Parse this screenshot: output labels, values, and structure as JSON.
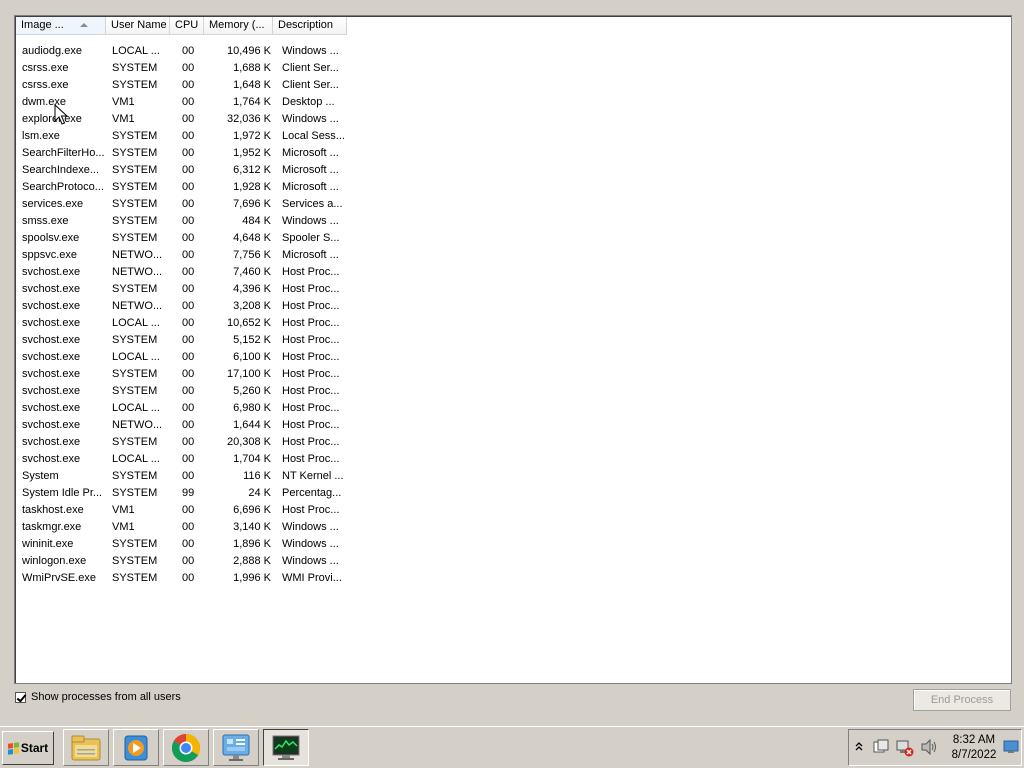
{
  "columns": [
    {
      "label": "Image ...",
      "sorted": true
    },
    {
      "label": "User Name"
    },
    {
      "label": "CPU"
    },
    {
      "label": "Memory (..."
    },
    {
      "label": "Description"
    }
  ],
  "processes": [
    {
      "image": "audiodg.exe",
      "user": "LOCAL ...",
      "cpu": "00",
      "memory": "10,496 K",
      "description": "Windows ..."
    },
    {
      "image": "csrss.exe",
      "user": "SYSTEM",
      "cpu": "00",
      "memory": "1,688 K",
      "description": "Client Ser..."
    },
    {
      "image": "csrss.exe",
      "user": "SYSTEM",
      "cpu": "00",
      "memory": "1,648 K",
      "description": "Client Ser..."
    },
    {
      "image": "dwm.exe",
      "user": "VM1",
      "cpu": "00",
      "memory": "1,764 K",
      "description": "Desktop ..."
    },
    {
      "image": "explorer.exe",
      "user": "VM1",
      "cpu": "00",
      "memory": "32,036 K",
      "description": "Windows ..."
    },
    {
      "image": "lsm.exe",
      "user": "SYSTEM",
      "cpu": "00",
      "memory": "1,972 K",
      "description": "Local Sess..."
    },
    {
      "image": "SearchFilterHo...",
      "user": "SYSTEM",
      "cpu": "00",
      "memory": "1,952 K",
      "description": "Microsoft ..."
    },
    {
      "image": "SearchIndexe...",
      "user": "SYSTEM",
      "cpu": "00",
      "memory": "6,312 K",
      "description": "Microsoft ..."
    },
    {
      "image": "SearchProtoco...",
      "user": "SYSTEM",
      "cpu": "00",
      "memory": "1,928 K",
      "description": "Microsoft ..."
    },
    {
      "image": "services.exe",
      "user": "SYSTEM",
      "cpu": "00",
      "memory": "7,696 K",
      "description": "Services a..."
    },
    {
      "image": "smss.exe",
      "user": "SYSTEM",
      "cpu": "00",
      "memory": "484 K",
      "description": "Windows ..."
    },
    {
      "image": "spoolsv.exe",
      "user": "SYSTEM",
      "cpu": "00",
      "memory": "4,648 K",
      "description": "Spooler S..."
    },
    {
      "image": "sppsvc.exe",
      "user": "NETWO...",
      "cpu": "00",
      "memory": "7,756 K",
      "description": "Microsoft ..."
    },
    {
      "image": "svchost.exe",
      "user": "NETWO...",
      "cpu": "00",
      "memory": "7,460 K",
      "description": "Host Proc..."
    },
    {
      "image": "svchost.exe",
      "user": "SYSTEM",
      "cpu": "00",
      "memory": "4,396 K",
      "description": "Host Proc..."
    },
    {
      "image": "svchost.exe",
      "user": "NETWO...",
      "cpu": "00",
      "memory": "3,208 K",
      "description": "Host Proc..."
    },
    {
      "image": "svchost.exe",
      "user": "LOCAL ...",
      "cpu": "00",
      "memory": "10,652 K",
      "description": "Host Proc..."
    },
    {
      "image": "svchost.exe",
      "user": "SYSTEM",
      "cpu": "00",
      "memory": "5,152 K",
      "description": "Host Proc..."
    },
    {
      "image": "svchost.exe",
      "user": "LOCAL ...",
      "cpu": "00",
      "memory": "6,100 K",
      "description": "Host Proc..."
    },
    {
      "image": "svchost.exe",
      "user": "SYSTEM",
      "cpu": "00",
      "memory": "17,100 K",
      "description": "Host Proc..."
    },
    {
      "image": "svchost.exe",
      "user": "SYSTEM",
      "cpu": "00",
      "memory": "5,260 K",
      "description": "Host Proc..."
    },
    {
      "image": "svchost.exe",
      "user": "LOCAL ...",
      "cpu": "00",
      "memory": "6,980 K",
      "description": "Host Proc..."
    },
    {
      "image": "svchost.exe",
      "user": "NETWO...",
      "cpu": "00",
      "memory": "1,644 K",
      "description": "Host Proc..."
    },
    {
      "image": "svchost.exe",
      "user": "SYSTEM",
      "cpu": "00",
      "memory": "20,308 K",
      "description": "Host Proc..."
    },
    {
      "image": "svchost.exe",
      "user": "LOCAL ...",
      "cpu": "00",
      "memory": "1,704 K",
      "description": "Host Proc..."
    },
    {
      "image": "System",
      "user": "SYSTEM",
      "cpu": "00",
      "memory": "116 K",
      "description": "NT Kernel ..."
    },
    {
      "image": "System Idle Pr...",
      "user": "SYSTEM",
      "cpu": "99",
      "memory": "24 K",
      "description": "Percentag..."
    },
    {
      "image": "taskhost.exe",
      "user": "VM1",
      "cpu": "00",
      "memory": "6,696 K",
      "description": "Host Proc..."
    },
    {
      "image": "taskmgr.exe",
      "user": "VM1",
      "cpu": "00",
      "memory": "3,140 K",
      "description": "Windows ..."
    },
    {
      "image": "wininit.exe",
      "user": "SYSTEM",
      "cpu": "00",
      "memory": "1,896 K",
      "description": "Windows ..."
    },
    {
      "image": "winlogon.exe",
      "user": "SYSTEM",
      "cpu": "00",
      "memory": "2,888 K",
      "description": "Windows ..."
    },
    {
      "image": "WmiPrvSE.exe",
      "user": "SYSTEM",
      "cpu": "00",
      "memory": "1,996 K",
      "description": "WMI Provi..."
    }
  ],
  "footer": {
    "show_all_label": "Show processes from all users",
    "show_all_checked": true,
    "end_process_label": "End Process",
    "end_process_enabled": false
  },
  "taskbar": {
    "start_label": "Start",
    "apps": [
      {
        "icon": "file-explorer-icon",
        "name": "Windows Explorer"
      },
      {
        "icon": "media-player-icon",
        "name": "Windows Media Player"
      },
      {
        "icon": "chrome-icon",
        "name": "Google Chrome"
      },
      {
        "icon": "control-panel-icon",
        "name": "Control Panel"
      },
      {
        "icon": "task-manager-icon",
        "name": "Task Manager",
        "active": true
      }
    ],
    "tray": {
      "time": "8:32 AM",
      "date": "8/7/2022"
    }
  },
  "colors": {
    "face": "#d4d0c8",
    "panel": "#ffffff",
    "disabled_text": "#9a9a9a"
  }
}
